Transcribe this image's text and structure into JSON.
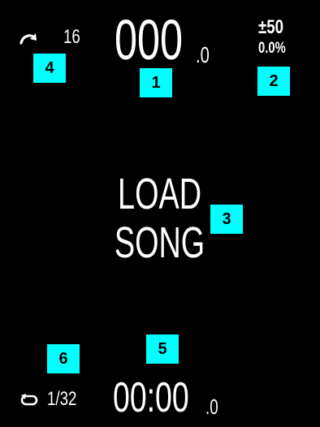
{
  "jump": {
    "icon": "redo-arrow-icon",
    "value": "16"
  },
  "bpm": {
    "main": "000",
    "decimal": ".0"
  },
  "pitch": {
    "range": "±50",
    "value": "0.0%"
  },
  "center": {
    "line1": "LOAD",
    "line2": "SONG"
  },
  "loop": {
    "icon": "loop-icon",
    "value": "1/32"
  },
  "time": {
    "main": "00:00",
    "decimal": ".0"
  },
  "callouts": [
    "1",
    "2",
    "3",
    "4",
    "5",
    "6"
  ],
  "colors": {
    "background": "#000000",
    "text": "#ffffff",
    "callout": "#00ffff"
  }
}
